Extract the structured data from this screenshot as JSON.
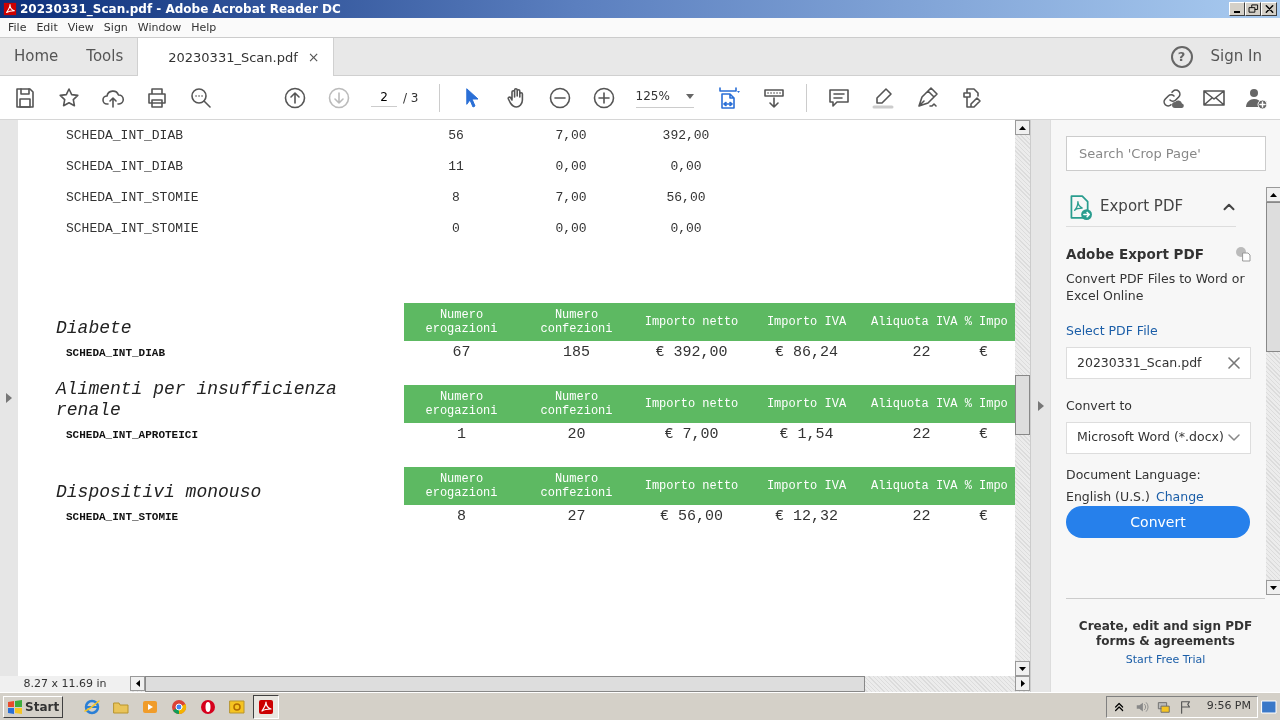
{
  "window": {
    "title": "20230331_Scan.pdf - Adobe Acrobat Reader DC"
  },
  "menu": [
    "File",
    "Edit",
    "View",
    "Sign",
    "Window",
    "Help"
  ],
  "tabs": [
    {
      "label": "Home",
      "selected": false
    },
    {
      "label": "Tools",
      "selected": false
    },
    {
      "label": "20230331_Scan.pdf",
      "selected": true,
      "close": "×"
    }
  ],
  "help": "?",
  "sign_in": "Sign In",
  "toolbar": {
    "page": "2",
    "page_count": "/ 3",
    "zoom": "125%"
  },
  "document": {
    "rows": [
      {
        "code": "SCHEDA_INT_DIAB",
        "col_2": "56",
        "col_3": "7,00",
        "col_4": "392,00"
      },
      {
        "code": "SCHEDA_INT_DIAB",
        "col_2": "11",
        "col_3": "0,00",
        "col_4": "0,00"
      },
      {
        "code": "SCHEDA_INT_STOMIE",
        "col_2": "8",
        "col_3": "7,00",
        "col_4": "56,00"
      },
      {
        "code": "SCHEDA_INT_STOMIE",
        "col_2": "0",
        "col_3": "0,00",
        "col_4": "0,00"
      }
    ],
    "sections": [
      {
        "title": "Diabete",
        "code": "SCHEDA_INT_DIAB",
        "headers": [
          "Numero erogazioni",
          "Numero confezioni",
          "Importo netto",
          "Importo IVA",
          "Aliquota IVA %",
          "Impo"
        ],
        "values": [
          "67",
          "185",
          "€ 392,00",
          "€ 86,24",
          "22",
          "€"
        ]
      },
      {
        "title": "Alimenti per insufficienza renale",
        "code": "SCHEDA_INT_APROTEICI",
        "headers": [
          "Numero erogazioni",
          "Numero confezioni",
          "Importo netto",
          "Importo IVA",
          "Aliquota IVA %",
          "Impo"
        ],
        "values": [
          "1",
          "20",
          "€ 7,00",
          "€ 1,54",
          "22",
          "€"
        ]
      },
      {
        "title": "Dispositivi monouso",
        "code": "SCHEDA_INT_STOMIE",
        "headers": [
          "Numero erogazioni",
          "Numero confezioni",
          "Importo netto",
          "Importo IVA",
          "Aliquota IVA %",
          "Impo"
        ],
        "values": [
          "8",
          "27",
          "€ 56,00",
          "€ 12,32",
          "22",
          "€"
        ]
      }
    ]
  },
  "status": {
    "page_size": "8.27 x 11.69 in"
  },
  "panel": {
    "search_placeholder": "Search 'Crop Page'",
    "tool": {
      "label": "Export PDF",
      "expanded": true
    },
    "heading": "Adobe Export PDF",
    "description": "Convert PDF Files to Word or Excel Online",
    "select_file": "Select PDF File",
    "file": "20230331_Scan.pdf",
    "convert_to": "Convert to",
    "format": "Microsoft Word (*.docx)",
    "language_label": "Document Language:",
    "language": "English (U.S.)",
    "change": "Change",
    "convert": "Convert",
    "promo": "Create, edit and sign PDF forms & agreements",
    "trial": "Start Free Trial"
  },
  "taskbar": {
    "start": "Start",
    "clock": "9:56 PM",
    "apps": [
      {
        "kind": "ie",
        "selected": false
      },
      {
        "kind": "folder",
        "selected": false
      },
      {
        "kind": "media",
        "selected": false
      },
      {
        "kind": "chrome",
        "selected": false
      },
      {
        "kind": "opera",
        "selected": false
      },
      {
        "kind": "outlook",
        "selected": false
      },
      {
        "kind": "acrobat",
        "selected": true
      }
    ]
  }
}
